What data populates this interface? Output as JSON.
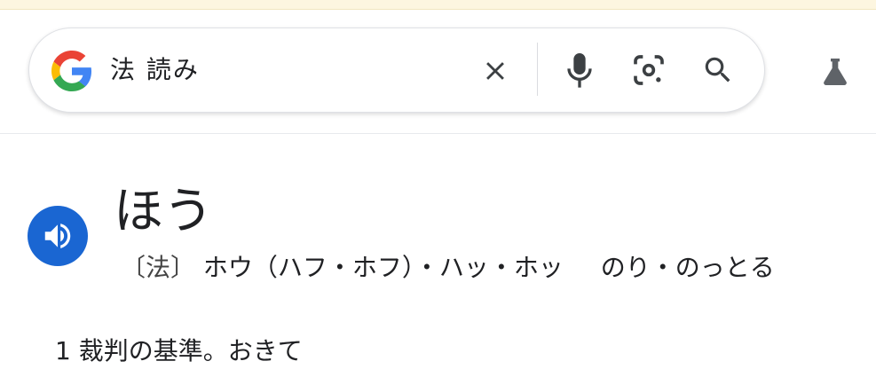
{
  "search": {
    "query": "法 読み",
    "icons": {
      "google": "google-g-logo",
      "clear": "close-icon",
      "mic": "microphone-icon",
      "lens": "camera-lens-icon",
      "search": "search-icon",
      "labs": "flask-icon"
    }
  },
  "entry": {
    "reading": "ほう",
    "kanji": "〔法〕",
    "on_readings": "ホウ（ハフ・ホフ）・ハッ・ホッ",
    "kun_readings": "のり・のっとる",
    "definition_1": "1 裁判の基準。おきて"
  },
  "colors": {
    "accent_blue": "#1a66d2",
    "text": "#202124"
  }
}
